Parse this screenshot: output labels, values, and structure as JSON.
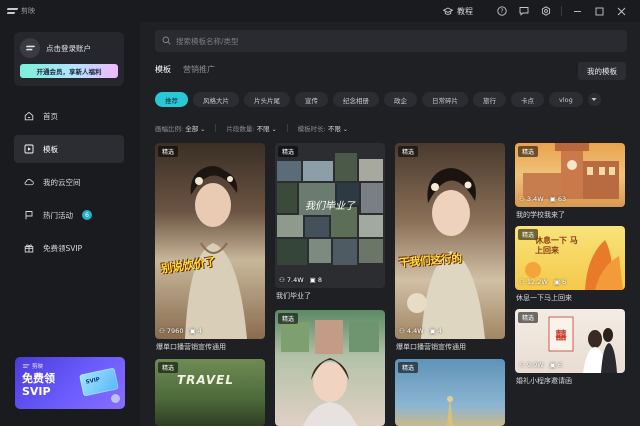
{
  "app": {
    "name": "剪映"
  },
  "titlebar": {
    "tutorial": "教程"
  },
  "sidebar": {
    "login": "点击登录账户",
    "vip_button": "开通会员，享新人福利",
    "nav": [
      {
        "label": "首页",
        "icon": "home-icon"
      },
      {
        "label": "模板",
        "icon": "template-icon"
      },
      {
        "label": "我的云空间",
        "icon": "cloud-icon"
      },
      {
        "label": "热门活动",
        "icon": "flag-icon",
        "badge": "6"
      },
      {
        "label": "免费领SVIP",
        "icon": "gift-icon"
      }
    ],
    "promo": {
      "brand": "剪映",
      "line1": "免费领",
      "line2": "SVIP",
      "card_text": "SVIP"
    }
  },
  "main": {
    "search_placeholder": "搜索模板名称/类型",
    "tabs": [
      "模板",
      "营销推广"
    ],
    "my_templates": "我的模板",
    "chips": [
      "推荐",
      "风格大片",
      "片头片尾",
      "宣传",
      "纪念相册",
      "政企",
      "日常碎片",
      "旅行",
      "卡点",
      "vlog"
    ],
    "filters": [
      {
        "label": "画幅比例:",
        "value": "全部"
      },
      {
        "label": "片段数量:",
        "value": "不限"
      },
      {
        "label": "模板时长:",
        "value": "不限"
      }
    ]
  },
  "cards": [
    {
      "tag": "精选",
      "overlay": "别说饮价了",
      "stat1": "7960",
      "stat2": "4",
      "title": "爆单口播营销宣传通用"
    },
    {
      "tag": "精选",
      "overlay": "",
      "stat1": "7.4W",
      "stat2": "8",
      "title": "我们毕业了"
    },
    {
      "tag": "精选",
      "overlay": "干我们这行的",
      "stat1": "4.4W",
      "stat2": "4",
      "title": "爆单口播营销宣传通用"
    },
    {
      "tag": "精选",
      "overlay": "",
      "stat1": "3.4W",
      "stat2": "63",
      "title": "我的学校我来了"
    },
    {
      "tag": "精选",
      "overlay": "休息一下 马上回来",
      "stat1": "12.2W",
      "stat2": "6",
      "title": "休息一下马上回来"
    },
    {
      "tag": "精选",
      "overlay": "",
      "stat1": "9.9W",
      "stat2": "6",
      "title": "婚礼小程序邀请函"
    },
    {
      "tag": "精选",
      "overlay": "TRAVEL",
      "stat1": "",
      "stat2": "",
      "title": ""
    },
    {
      "tag": "精选",
      "overlay": "",
      "stat1": "",
      "stat2": "",
      "title": ""
    },
    {
      "tag": "精选",
      "overlay": "",
      "stat1": "",
      "stat2": "",
      "title": ""
    }
  ],
  "colors": {
    "accent": "#2ac7d6",
    "background": "#1f2024",
    "sidebar": "#1a1b1f"
  }
}
